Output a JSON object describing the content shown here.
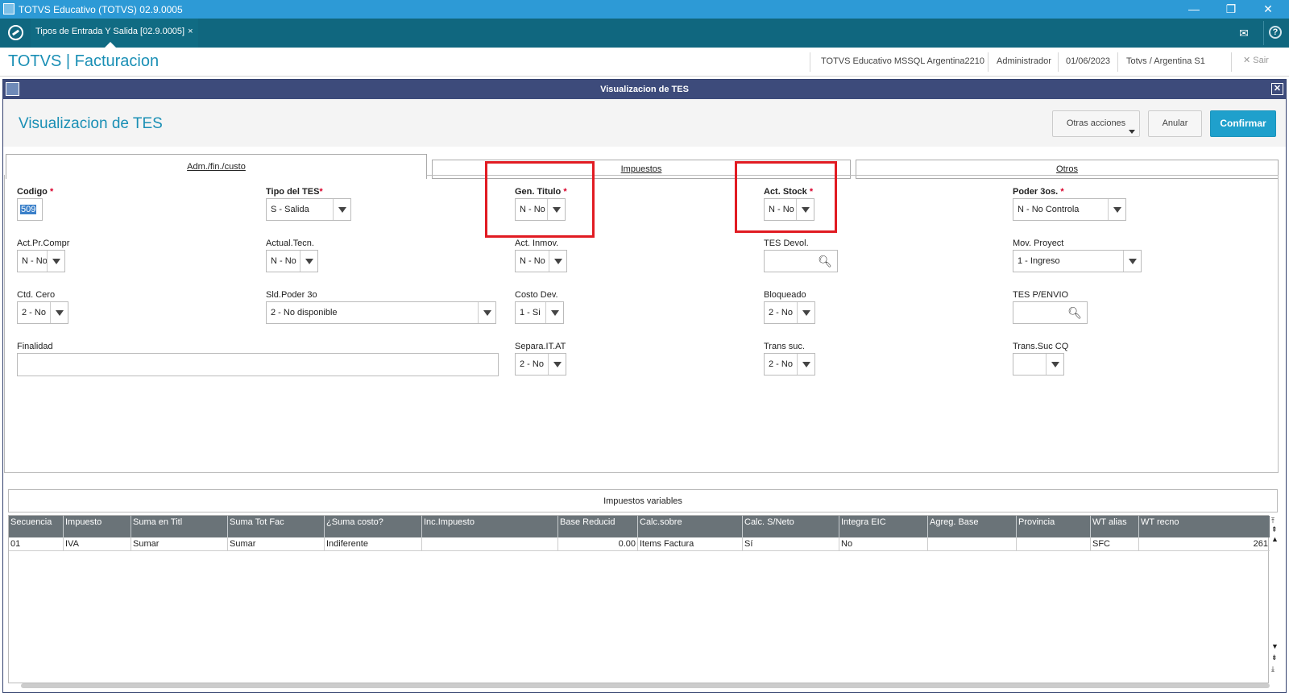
{
  "os": {
    "title": "TOTVS Educativo (TOTVS) 02.9.0005",
    "min": "—",
    "restore": "❐",
    "close": "✕"
  },
  "tabbar": {
    "tab_label": "Tipos de Entrada Y Salida [02.9.0005]",
    "tab_close": "×",
    "mail_icon": "✉",
    "help_icon": "?"
  },
  "header": {
    "brand": "TOTVS | Facturacion",
    "environment": "TOTVS Educativo MSSQL Argentina2210",
    "user": "Administrador",
    "date": "01/06/2023",
    "branch": "Totvs / Argentina S1",
    "exit": "✕  Sair"
  },
  "dialog": {
    "title": "Visualizacion de TES",
    "page_title": "Visualizacion de TES",
    "buttons": {
      "other_actions": "Otras acciones",
      "cancel": "Anular",
      "confirm": "Confirmar"
    },
    "tabs": [
      "Adm./fin./custo",
      "Impuestos",
      "Otros"
    ]
  },
  "form": {
    "codigo": {
      "label": "Codigo",
      "value": "509"
    },
    "tipo_tes": {
      "label": "Tipo del TES",
      "value": "S - Salida"
    },
    "gen_titulo": {
      "label": "Gen. Titulo",
      "value": "N - No"
    },
    "act_stock": {
      "label": "Act. Stock",
      "value": "N - No"
    },
    "poder_3os": {
      "label": "Poder 3os.",
      "value": "N - No Controla"
    },
    "act_pr_compr": {
      "label": "Act.Pr.Compr",
      "value": "N - No"
    },
    "actual_tecn": {
      "label": "Actual.Tecn.",
      "value": "N - No"
    },
    "act_inmov": {
      "label": "Act. Inmov.",
      "value": "N - No"
    },
    "tes_devol": {
      "label": "TES Devol.",
      "value": ""
    },
    "mov_proyect": {
      "label": "Mov. Proyect",
      "value": "1 - Ingreso"
    },
    "ctd_cero": {
      "label": "Ctd. Cero",
      "value": "2 - No"
    },
    "sld_poder_3o": {
      "label": "Sld.Poder 3o",
      "value": "2 - No disponible"
    },
    "costo_dev": {
      "label": "Costo Dev.",
      "value": "1 - Si"
    },
    "bloqueado": {
      "label": "Bloqueado",
      "value": "2 - No"
    },
    "tes_penvio": {
      "label": "TES P/ENVIO",
      "value": ""
    },
    "finalidad": {
      "label": "Finalidad",
      "value": ""
    },
    "separa_it_at": {
      "label": "Separa.IT.AT",
      "value": "2 - No"
    },
    "trans_suc": {
      "label": "Trans suc.",
      "value": "2 - No"
    },
    "trans_suc_cq": {
      "label": "Trans.Suc CQ",
      "value": ""
    }
  },
  "grid": {
    "title": "Impuestos variables",
    "columns": [
      "Secuencia",
      "Impuesto",
      "Suma en Titl",
      "Suma Tot Fac",
      "¿Suma costo?",
      "Inc.Impuesto",
      "Base Reducid",
      "Calc.sobre",
      "Calc. S/Neto",
      "Integra EIC",
      "Agreg. Base",
      "Provincia",
      "WT alias",
      "WT recno"
    ],
    "rows": [
      [
        "01",
        "IVA",
        "Sumar",
        "Sumar",
        "Indiferente",
        "",
        "0.00",
        "Items Factura",
        "Sí",
        "No",
        "",
        "",
        "SFC",
        "261"
      ]
    ]
  },
  "colors": {
    "accent": "#1a8fb5",
    "highlight": "#e11b22",
    "dialog_title": "#3d4b7b"
  }
}
